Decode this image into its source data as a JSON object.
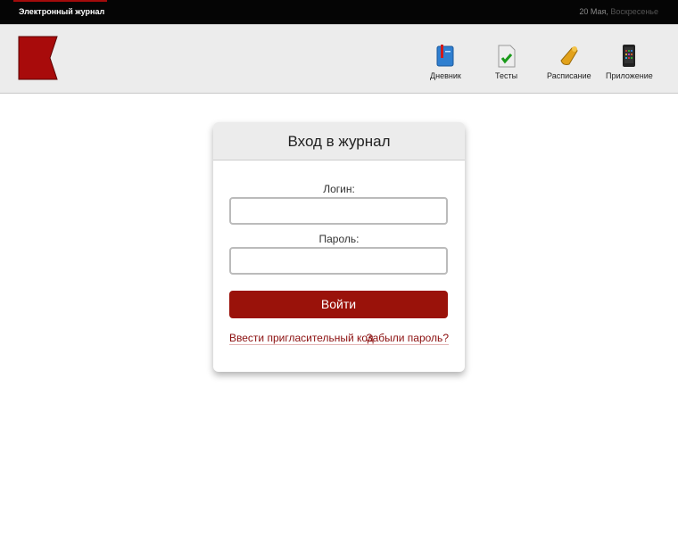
{
  "topbar": {
    "site_title": "Электронный журнал",
    "date": "20 Мая,",
    "weekday": "Воскресенье"
  },
  "nav": [
    {
      "label": "Дневник",
      "icon": "diary-book-icon"
    },
    {
      "label": "Тесты",
      "icon": "test-checkmark-icon"
    },
    {
      "label": "Расписание",
      "icon": "bell-icon"
    },
    {
      "label": "Приложение",
      "icon": "phone-app-icon"
    }
  ],
  "login": {
    "title": "Вход в журнал",
    "login_label": "Логин:",
    "login_value": "",
    "password_label": "Пароль:",
    "password_value": "",
    "submit_label": "Войти",
    "invite_link": "Ввести пригласительный код",
    "forgot_link": "Забыли пароль?"
  },
  "colors": {
    "accent": "#9a120a",
    "logo": "#a80b0b"
  }
}
